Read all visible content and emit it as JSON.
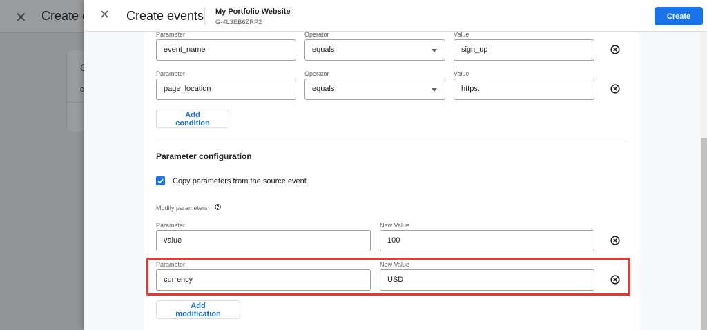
{
  "background": {
    "title": "Create e",
    "card_title": "C",
    "card_text": "c"
  },
  "panel": {
    "title": "Create events",
    "property_name": "My Portfolio Website",
    "property_id": "G-4L3EB6ZRP2",
    "create_label": "Create"
  },
  "conditions": {
    "rows": [
      {
        "parameter_label": "Parameter",
        "parameter": "event_name",
        "operator_label": "Operator",
        "operator": "equals",
        "value_label": "Value",
        "value": "sign_up"
      },
      {
        "parameter_label": "Parameter",
        "parameter": "page_location",
        "operator_label": "Operator",
        "operator": "equals",
        "value_label": "Value",
        "value": "https."
      }
    ],
    "add_label": "Add condition"
  },
  "parameter_config": {
    "title": "Parameter configuration",
    "copy_label": "Copy parameters from the source event",
    "copy_checked": true,
    "modify_label": "Modify parameters",
    "modifications": [
      {
        "parameter_label": "Parameter",
        "parameter": "value",
        "new_value_label": "New Value",
        "new_value": "100"
      },
      {
        "parameter_label": "Parameter",
        "parameter": "currency",
        "new_value_label": "New Value",
        "new_value": "USD"
      }
    ],
    "add_label": "Add modification"
  },
  "icons": {
    "close": "close-icon",
    "remove": "remove-circle-icon",
    "help": "help-icon",
    "dropdown": "chevron-down-icon",
    "check": "check-icon"
  },
  "colors": {
    "accent": "#1a73e8",
    "highlight": "#e53935"
  }
}
